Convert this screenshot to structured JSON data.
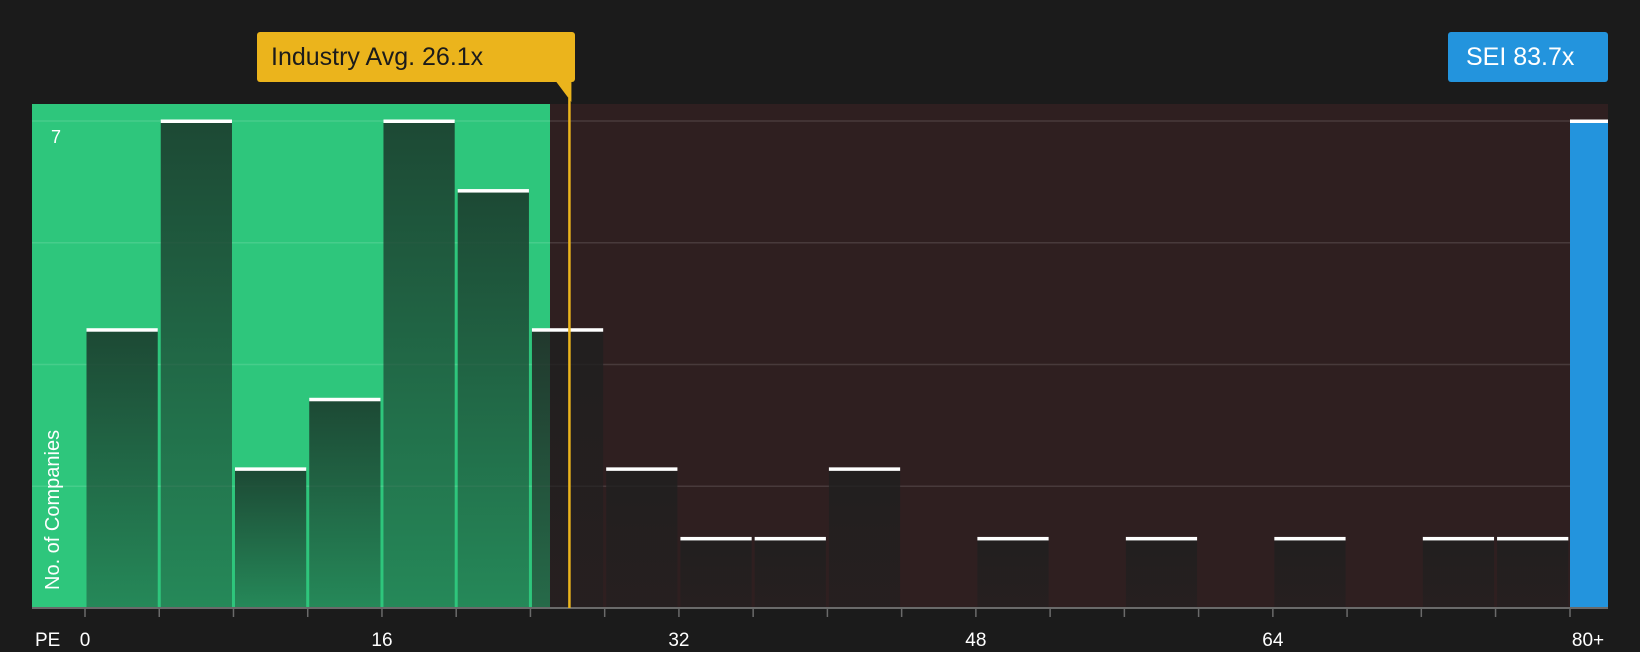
{
  "chart_data": {
    "type": "bar",
    "xlabel": "PE",
    "ylabel": "No. of Companies",
    "y_top_label": "7",
    "ylim": [
      0,
      7
    ],
    "grid": true,
    "x_tick_labels": [
      "0",
      "16",
      "32",
      "48",
      "64",
      "80+"
    ],
    "bin_width": 4,
    "bins": [
      {
        "start": 0,
        "count": 4
      },
      {
        "start": 4,
        "count": 7
      },
      {
        "start": 8,
        "count": 2
      },
      {
        "start": 12,
        "count": 3
      },
      {
        "start": 16,
        "count": 7
      },
      {
        "start": 20,
        "count": 6
      },
      {
        "start": 24,
        "count": 4
      },
      {
        "start": 28,
        "count": 2
      },
      {
        "start": 32,
        "count": 1
      },
      {
        "start": 36,
        "count": 1
      },
      {
        "start": 40,
        "count": 2
      },
      {
        "start": 48,
        "count": 1
      },
      {
        "start": 56,
        "count": 1
      },
      {
        "start": 64,
        "count": 1
      },
      {
        "start": 72,
        "count": 1
      },
      {
        "start": 76,
        "count": 1
      }
    ],
    "industry_avg": {
      "value": 26.1,
      "label": "Industry Avg. 26.1x"
    },
    "company": {
      "name": "SEI",
      "value": 83.7,
      "label": "SEI 83.7x",
      "count": 7
    }
  },
  "colors": {
    "background": "#1b1b1b",
    "undervalued_region": "#2ec67c",
    "overvalued_region": "#2f1f20",
    "industry_avg": "#ebb41c",
    "company": "#2394dd"
  }
}
